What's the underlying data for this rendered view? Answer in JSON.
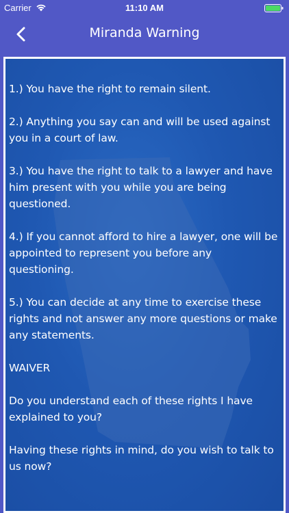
{
  "status_bar": {
    "carrier": "Carrier",
    "time": "11:10 AM",
    "wifi_icon": "wifi-icon",
    "battery_icon": "battery-icon"
  },
  "nav": {
    "title": "Miranda Warning",
    "back_icon": "chevron-left-icon"
  },
  "colors": {
    "header": "#5158c6",
    "content_bg": "#1f58b2",
    "battery_fill": "#4cd964",
    "text": "#ffffff"
  },
  "content": {
    "paragraphs": [
      "1.) You have the right to remain silent.",
      "2.) Anything you say can and will be used against you in a court of law.",
      "3.) You have the right to talk to a lawyer and have him present with you while you are being questioned.",
      "4.) If you cannot afford to hire a lawyer, one will be appointed to represent you before any questioning.",
      "5.) You can decide at any time to exercise these rights and not answer any more questions or make any statements.",
      "WAIVER",
      "Do you understand each of these rights I have explained to you?",
      "Having these rights in mind, do you wish to talk to us now?"
    ]
  }
}
